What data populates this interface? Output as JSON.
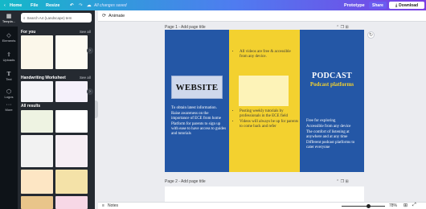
{
  "topbar": {
    "home": "Home",
    "file": "File",
    "resize": "Resize",
    "undo_icon": "undo-icon",
    "redo_icon": "redo-icon",
    "save_status": "All changes saved",
    "prototype": "Prototype",
    "share": "Share",
    "download": "Download"
  },
  "rail": {
    "items": [
      {
        "label": "Templa...",
        "icon": "template-icon"
      },
      {
        "label": "Elements",
        "icon": "elements-icon"
      },
      {
        "label": "Uploads",
        "icon": "upload-icon"
      },
      {
        "label": "Text",
        "icon": "text-icon"
      },
      {
        "label": "Logos",
        "icon": "logo-icon"
      },
      {
        "label": "More",
        "icon": "more-icon"
      }
    ]
  },
  "panel": {
    "search_placeholder": "Search A4 (Landscape) tem",
    "for_you": "For you",
    "see_all_1": "See all",
    "handwriting": "Handwriting Worksheet",
    "see_all_2": "See all",
    "all_results": "All results"
  },
  "toolbar": {
    "animate": "Animate"
  },
  "page1": {
    "label": "Page 1 - Add page title",
    "website_title": "WEBSITE",
    "website_bullets": [
      "To obtain latest information.",
      "Raise awareness on the importance of ECE from home",
      "Platform for parents to sign up with ease to have access to guides and tutorials"
    ],
    "middle_bullets_top": [
      "All videos are free & accessible from any device."
    ],
    "middle_bullets_bottom": [
      "Posting weekly tutorials by professionals in the ECE field",
      "Videos will always be up for parents to come back and refer"
    ],
    "podcast_title": "PODCAST",
    "podcast_subtitle": "Podcast platforms",
    "podcast_bullets": [
      "Free for exploring",
      "Accessible from any device",
      "The comfort of listening at anywhere and at any time",
      "Different podcast platforms to cater everyone"
    ]
  },
  "page2": {
    "label": "Page 2 - Add page title"
  },
  "bottombar": {
    "notes": "Notes",
    "zoom": "78%",
    "zoom_fraction": 0.78
  },
  "colors": {
    "blue": "#2457a6",
    "yellow": "#f3d12f",
    "download_bg": "#ffffff"
  }
}
